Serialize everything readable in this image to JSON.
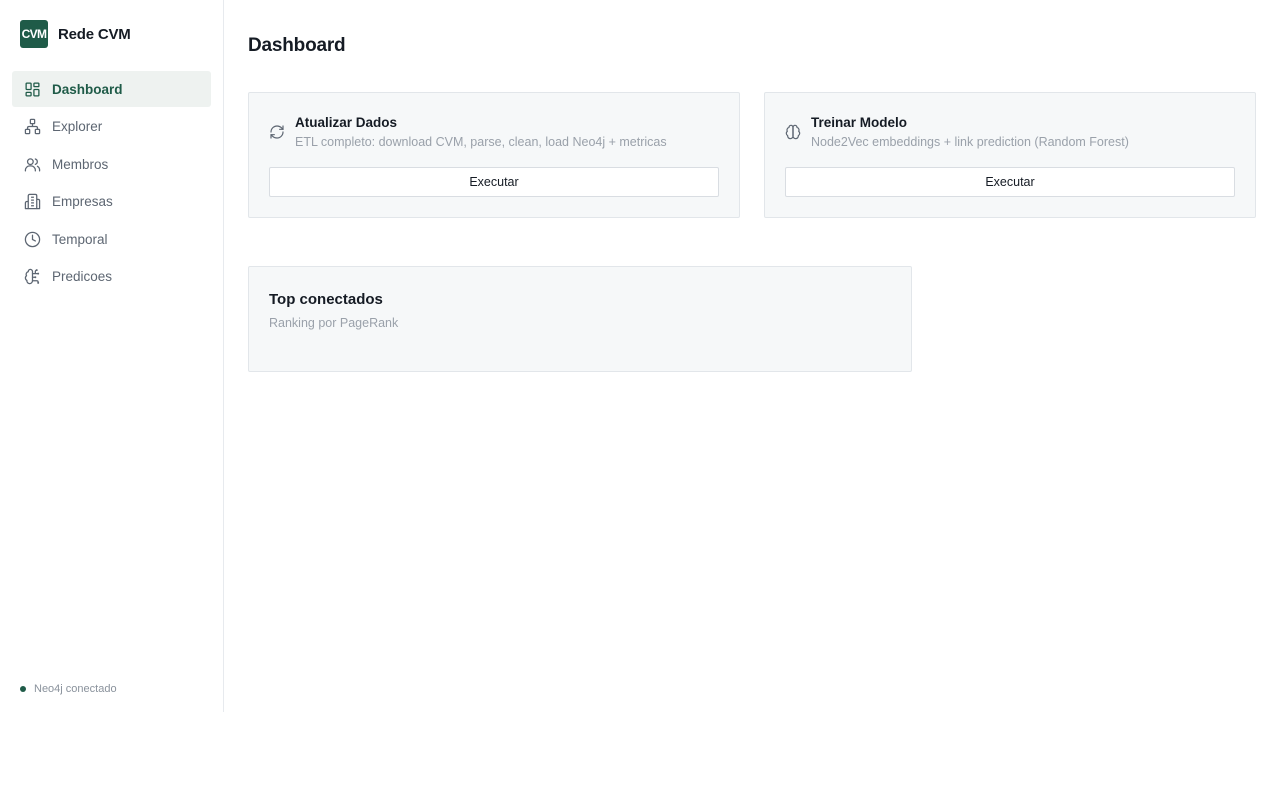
{
  "brand": {
    "logo_text": "CVM",
    "name": "Rede CVM"
  },
  "sidebar": {
    "items": [
      {
        "label": "Dashboard",
        "icon": "dashboard-icon",
        "active": true
      },
      {
        "label": "Explorer",
        "icon": "network-icon",
        "active": false
      },
      {
        "label": "Membros",
        "icon": "users-icon",
        "active": false
      },
      {
        "label": "Empresas",
        "icon": "building-icon",
        "active": false
      },
      {
        "label": "Temporal",
        "icon": "clock-icon",
        "active": false
      },
      {
        "label": "Predicoes",
        "icon": "brain-circuit-icon",
        "active": false
      }
    ],
    "status": {
      "text": "Neo4j conectado",
      "color": "#1f5b48"
    }
  },
  "main": {
    "title": "Dashboard",
    "actions": [
      {
        "icon": "refresh-icon",
        "title": "Atualizar Dados",
        "description": "ETL completo: download CVM, parse, clean, load Neo4j + metricas",
        "button_label": "Executar"
      },
      {
        "icon": "brain-icon",
        "title": "Treinar Modelo",
        "description": "Node2Vec embeddings + link prediction (Random Forest)",
        "button_label": "Executar"
      }
    ],
    "top_connected": {
      "title": "Top conectados",
      "subtitle": "Ranking por PageRank"
    }
  },
  "colors": {
    "accent": "#1f5b48",
    "active_bg": "#eef2f0",
    "card_bg": "#f6f8f9"
  }
}
